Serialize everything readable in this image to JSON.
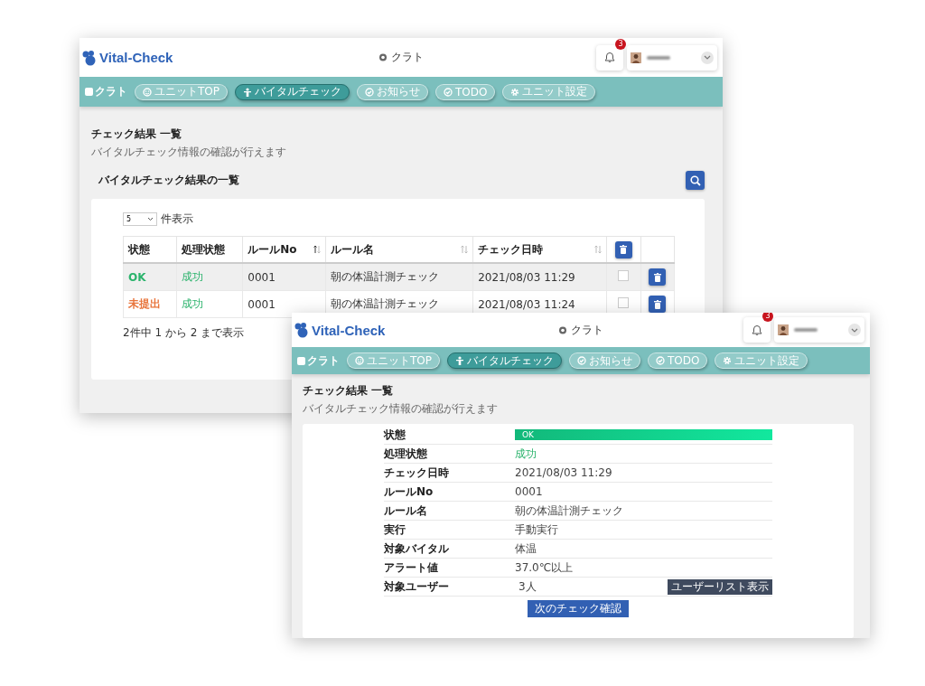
{
  "windows": [
    {
      "kind": "list",
      "header": {
        "logo": "Vital-Check",
        "organization": "クラト",
        "notification_count": "3"
      },
      "nav": {
        "organization": "クラト",
        "items": [
          {
            "label": "ユニットTOP",
            "selected": false
          },
          {
            "label": "バイタルチェック",
            "selected": true
          },
          {
            "label": "お知らせ",
            "selected": false
          },
          {
            "label": "TODO",
            "selected": false
          },
          {
            "label": "ユニット設定",
            "selected": false
          }
        ]
      },
      "page_title": "チェック結果 一覧",
      "page_subtitle": "バイタルチェック情報の確認が行えます",
      "section_title": "バイタルチェック結果の一覧",
      "page_length": {
        "value": "5",
        "label": "件表示"
      },
      "table": {
        "columns": [
          {
            "label": "状態",
            "sortable": false
          },
          {
            "label": "処理状態",
            "sortable": false
          },
          {
            "label": "ルールNo",
            "sortable": true,
            "sorted_ascending": true
          },
          {
            "label": "ルール名",
            "sortable": true,
            "sorted_ascending": false
          },
          {
            "label": "チェック日時",
            "sortable": true,
            "sorted_ascending": false
          }
        ],
        "rows": [
          {
            "status": "OK",
            "color": "#2bb36c",
            "process": "成功",
            "rule_no": "0001",
            "rule_name": "朝の体温計測チェック",
            "checked_at": "2021/08/03 11:29",
            "checked": false,
            "highlighted": true
          },
          {
            "status": "未提出",
            "color": "#e8743b",
            "process": "成功",
            "rule_no": "0001",
            "rule_name": "朝の体温計測チェック",
            "checked_at": "2021/08/03 11:24",
            "checked": false,
            "highlighted": false
          }
        ]
      },
      "footer": "2件中 1 から 2 まで表示"
    },
    {
      "kind": "detail",
      "header": {
        "logo": "Vital-Check",
        "organization": "クラト",
        "notification_count": "3"
      },
      "nav": {
        "organization": "クラト",
        "items": [
          {
            "label": "ユニットTOP",
            "selected": false
          },
          {
            "label": "バイタルチェック",
            "selected": true
          },
          {
            "label": "お知らせ",
            "selected": false
          },
          {
            "label": "TODO",
            "selected": false
          },
          {
            "label": "ユニット設定",
            "selected": false
          }
        ]
      },
      "page_title": "チェック結果 一覧",
      "page_subtitle": "バイタルチェック情報の確認が行えます",
      "details": [
        {
          "label": "状態",
          "kind": "status-bar",
          "value": "OK"
        },
        {
          "label": "処理状態",
          "kind": "success",
          "value": "成功"
        },
        {
          "label": "チェック日時",
          "kind": "text",
          "value": "2021/08/03 11:29"
        },
        {
          "label": "ルールNo",
          "kind": "text",
          "value": "0001"
        },
        {
          "label": "ルール名",
          "kind": "text",
          "value": "朝の体温計測チェック"
        },
        {
          "label": "実行",
          "kind": "text",
          "value": "手動実行"
        },
        {
          "label": "対象バイタル",
          "kind": "text",
          "value": "体温"
        },
        {
          "label": "アラート値",
          "kind": "text",
          "value": "37.0℃以上"
        },
        {
          "label": "対象ユーザー",
          "kind": "action",
          "value": "3人",
          "action": "ユーザーリスト表示"
        }
      ],
      "next_button": "次のチェック確認"
    }
  ]
}
